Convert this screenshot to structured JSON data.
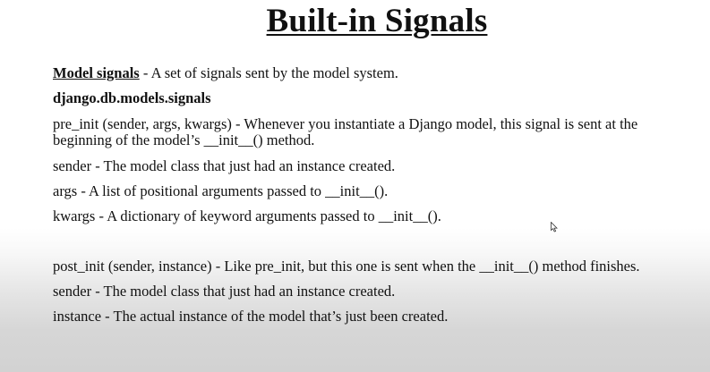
{
  "slide": {
    "title": "Built-in Signals",
    "model_signals": {
      "label": "Model signals",
      "description": " - A set of signals sent by the model system."
    },
    "module_path": "django.db.models.signals",
    "pre_init": {
      "signature": "pre_init (sender, args, kwargs) - Whenever you instantiate a Django model, this signal is sent at the beginning of the model’s __init__() method.",
      "sender": "sender - The model class that just had an instance created.",
      "args": "args - A list of positional arguments passed to __init__().",
      "kwargs": "kwargs - A dictionary of keyword arguments passed to __init__()."
    },
    "post_init": {
      "signature": "post_init (sender, instance) - Like pre_init, but this one is sent when the __init__() method finishes.",
      "sender": "sender - The model class that just had an instance created.",
      "instance": "instance - The actual instance of the model that’s just been created."
    }
  }
}
